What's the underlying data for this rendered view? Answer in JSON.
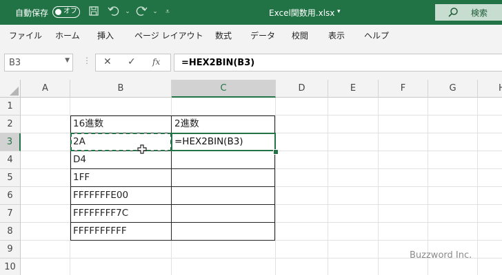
{
  "titlebar": {
    "autosave_label": "自動保存",
    "autosave_state": "オフ",
    "file_name": "Excel関数用.xlsx",
    "file_dropdown": "▾",
    "search_label": "検索"
  },
  "ribbon": {
    "tabs": [
      "ファイル",
      "ホーム",
      "挿入",
      "ページ レイアウト",
      "数式",
      "データ",
      "校閲",
      "表示",
      "ヘルプ"
    ]
  },
  "formula_bar": {
    "name_box": "B3",
    "fx_label": "fx",
    "formula": "=HEX2BIN(B3)"
  },
  "grid": {
    "columns": [
      "A",
      "B",
      "C",
      "D",
      "E",
      "F",
      "G",
      "H"
    ],
    "selected_column": "C",
    "rows": [
      "1",
      "2",
      "3",
      "4",
      "5",
      "6",
      "7",
      "8",
      "9",
      "10"
    ],
    "selected_row": "3",
    "header_b": "16進数",
    "header_c": "2進数",
    "values_b": [
      "2A",
      "D4",
      "1FF",
      "FFFFFFFE00",
      "FFFFFFFF7C",
      "FFFFFFFFFF"
    ],
    "active_cell_text": "=HEX2BIN(B3)"
  },
  "watermark": "Buzzword Inc.",
  "colors": {
    "accent": "#217346",
    "title_bg": "#217346",
    "ribbon_bg": "#f3f3f3"
  }
}
